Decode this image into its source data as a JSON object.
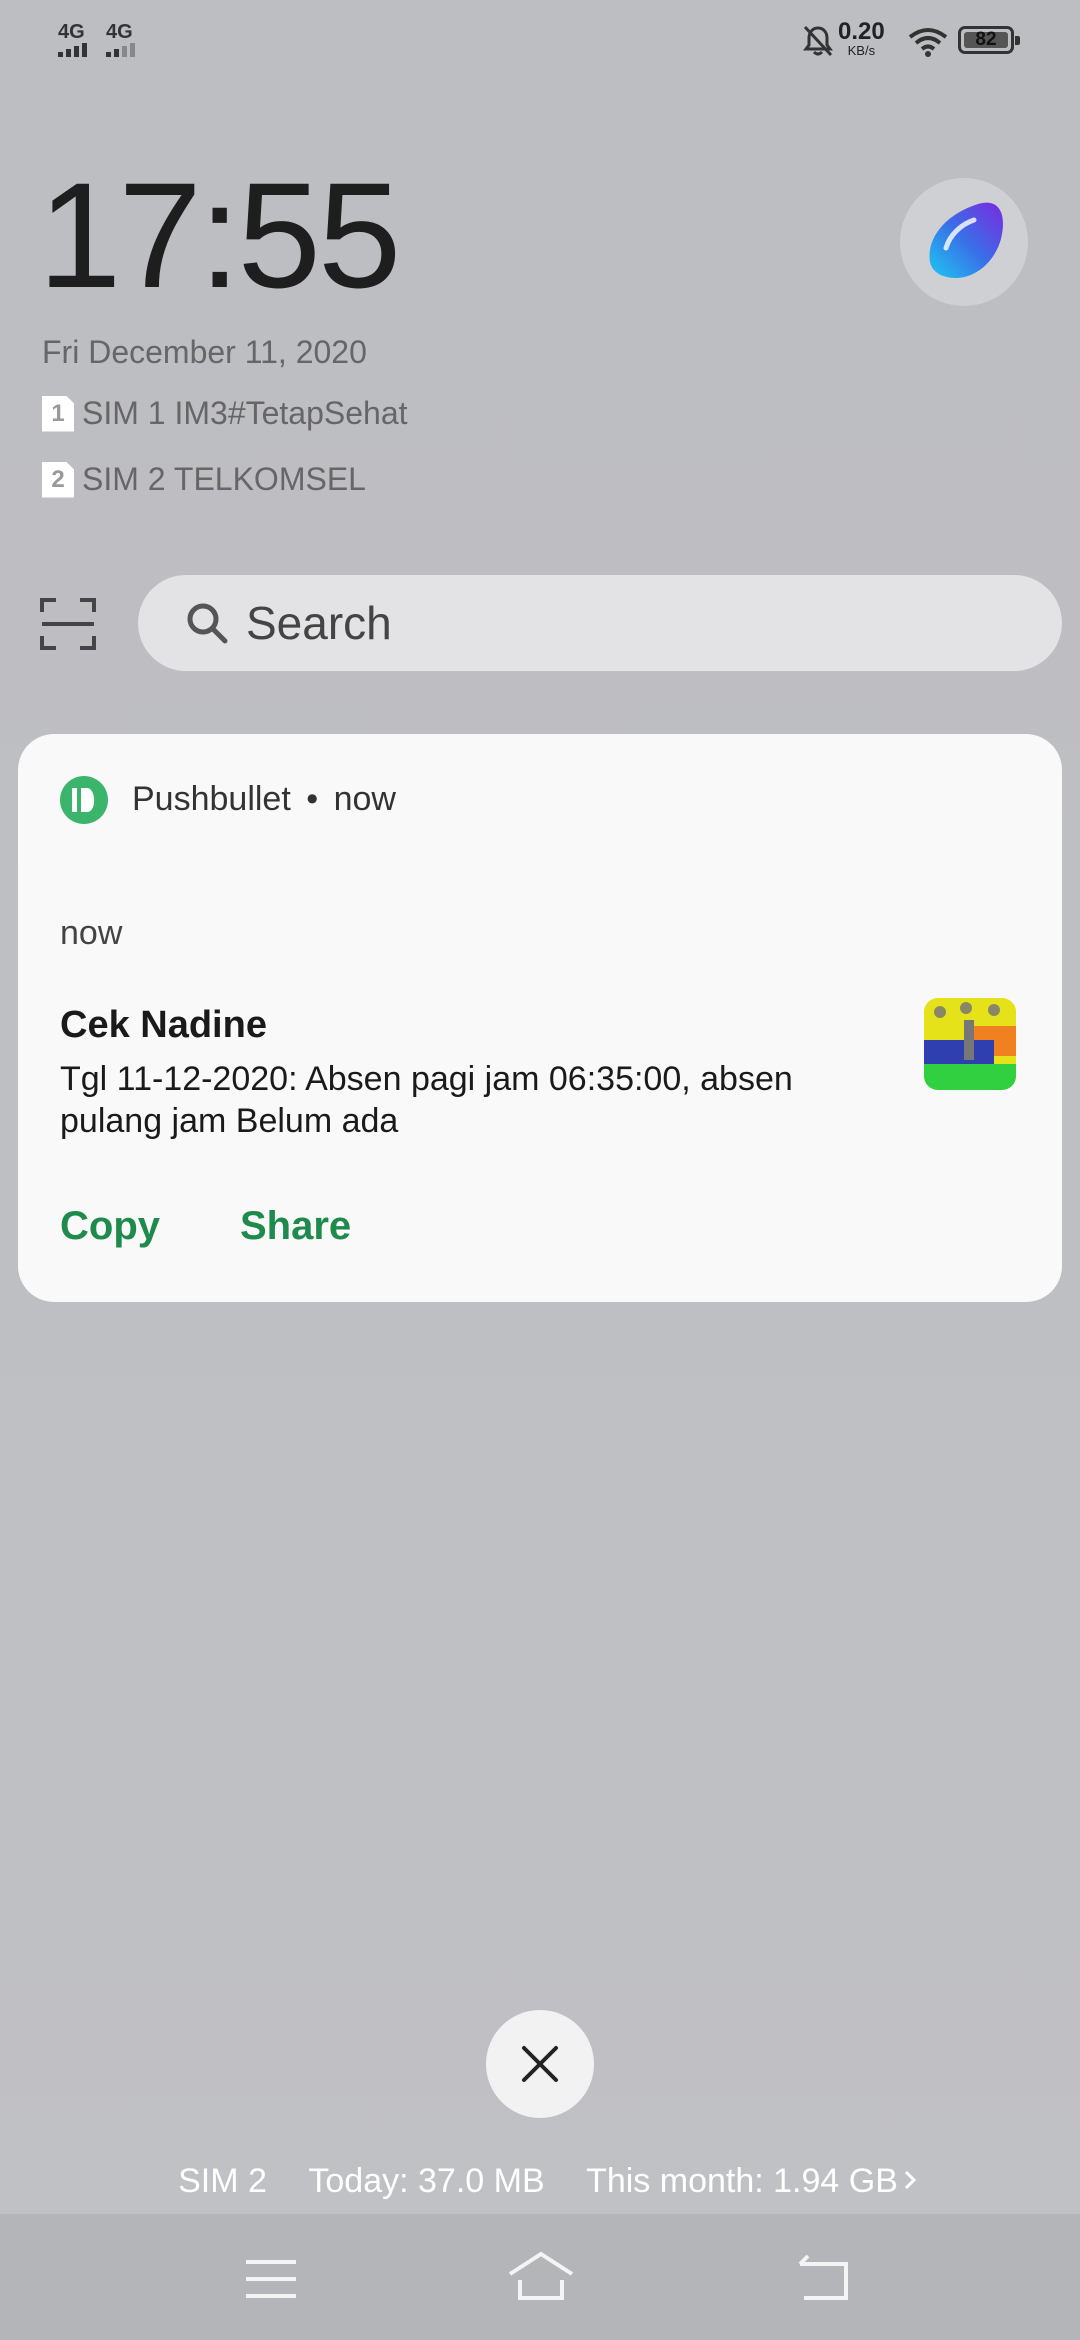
{
  "status_bar": {
    "sim1_network": "4G",
    "sim2_network": "4G",
    "net_speed_value": "0.20",
    "net_speed_unit": "KB/s",
    "battery_level": "82",
    "icons": [
      "mute-icon",
      "wifi-icon",
      "battery-icon"
    ]
  },
  "lockscreen": {
    "time": "17:55",
    "date": "Fri December 11, 2020",
    "sims": [
      {
        "slot": "1",
        "label": "SIM 1 IM3#TetapSehat"
      },
      {
        "slot": "2",
        "label": "SIM 2 TELKOMSEL"
      }
    ]
  },
  "search": {
    "placeholder": "Search"
  },
  "notification": {
    "app_name": "Pushbullet",
    "time_header": "now",
    "time_body": "now",
    "title": "Cek Nadine",
    "body": "Tgl 11-12-2020: Absen pagi jam 06:35:00, absen pulang jam Belum ada",
    "actions": [
      "Copy",
      "Share"
    ],
    "accent_color": "#1e8a4c",
    "app_icon_color": "#3bb56b"
  },
  "data_usage": {
    "sim": "SIM 2",
    "today": "Today: 37.0 MB",
    "month": "This month: 1.94 GB"
  },
  "navigation": {
    "buttons": [
      "menu-icon",
      "home-icon",
      "back-icon"
    ]
  }
}
